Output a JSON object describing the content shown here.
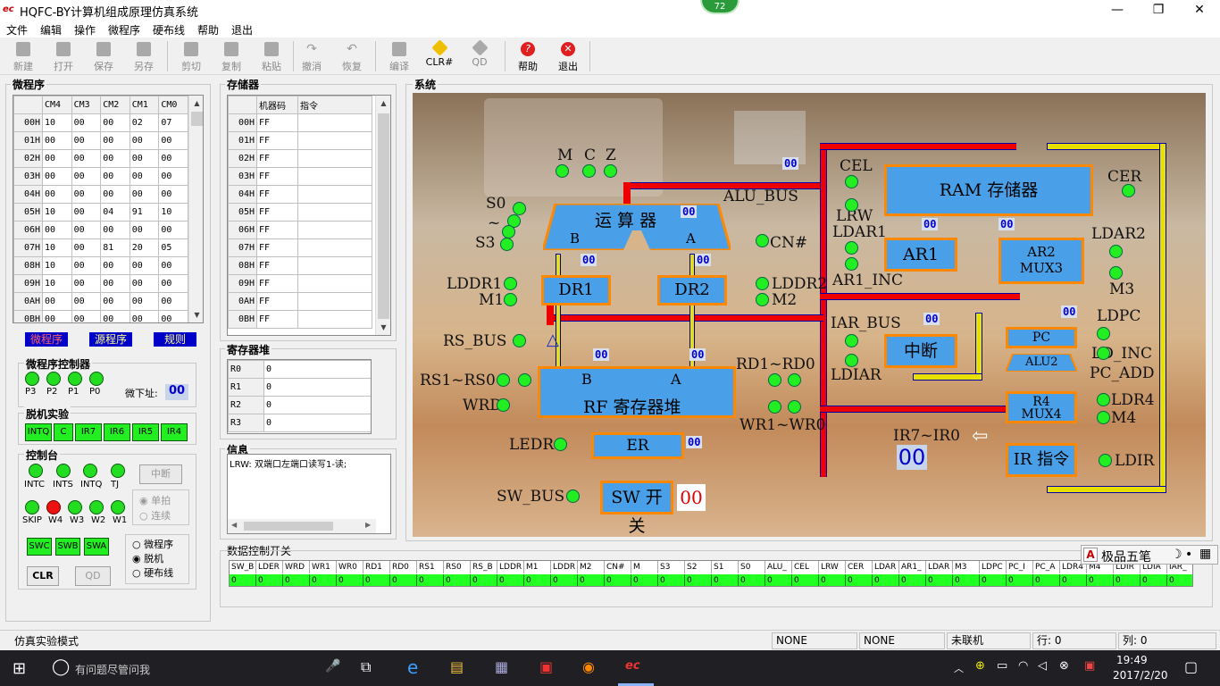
{
  "window": {
    "title": "HQFC-BY计算机组成原理仿真系统",
    "logo": "ec",
    "badge": "72",
    "btn_min": "—",
    "btn_max": "❐",
    "btn_close": "✕"
  },
  "menu": [
    "文件",
    "编辑",
    "操作",
    "微程序",
    "硬布线",
    "帮助",
    "退出"
  ],
  "toolbar": [
    "新建",
    "打开",
    "保存",
    "另存",
    "剪切",
    "复制",
    "粘贴",
    "撤消",
    "恢复",
    "编译",
    "CLR#",
    "QD",
    "帮助",
    "退出"
  ],
  "micro": {
    "title": "微程序",
    "cols": [
      "CM4",
      "CM3",
      "CM2",
      "CM1",
      "CM0"
    ],
    "rows": [
      {
        "addr": "00H",
        "v": [
          "10",
          "00",
          "00",
          "02",
          "07"
        ]
      },
      {
        "addr": "01H",
        "v": [
          "00",
          "00",
          "00",
          "00",
          "00"
        ]
      },
      {
        "addr": "02H",
        "v": [
          "00",
          "00",
          "00",
          "00",
          "00"
        ]
      },
      {
        "addr": "03H",
        "v": [
          "00",
          "00",
          "00",
          "00",
          "00"
        ]
      },
      {
        "addr": "04H",
        "v": [
          "00",
          "00",
          "00",
          "00",
          "00"
        ]
      },
      {
        "addr": "05H",
        "v": [
          "10",
          "00",
          "04",
          "91",
          "10"
        ]
      },
      {
        "addr": "06H",
        "v": [
          "00",
          "00",
          "00",
          "00",
          "00"
        ]
      },
      {
        "addr": "07H",
        "v": [
          "10",
          "00",
          "81",
          "20",
          "05"
        ]
      },
      {
        "addr": "08H",
        "v": [
          "10",
          "00",
          "00",
          "00",
          "00"
        ]
      },
      {
        "addr": "09H",
        "v": [
          "10",
          "00",
          "00",
          "00",
          "00"
        ]
      },
      {
        "addr": "0AH",
        "v": [
          "00",
          "00",
          "00",
          "00",
          "00"
        ]
      },
      {
        "addr": "0BH",
        "v": [
          "00",
          "00",
          "00",
          "00",
          "00"
        ]
      }
    ],
    "btn_micro": "微程序",
    "btn_src": "源程序",
    "btn_rule": "规则"
  },
  "mpc": {
    "title": "微程序控制器",
    "leds": [
      "P3",
      "P2",
      "P1",
      "P0"
    ],
    "addr_label": "微下址:",
    "addr_value": "00"
  },
  "offline": {
    "title": "脱机实验",
    "btns": [
      "INTQ",
      "C",
      "IR7",
      "IR6",
      "IR5",
      "IR4"
    ]
  },
  "console": {
    "title": "控制台",
    "leds1": [
      "INTC",
      "INTS",
      "INTQ",
      "TJ"
    ],
    "leds2": [
      "SKIP",
      "W4",
      "W3",
      "W2",
      "W1"
    ],
    "interrupt": "中断",
    "single": "单拍",
    "cont": "连续",
    "sw": [
      "SWC",
      "SWB",
      "SWA"
    ],
    "clr": "CLR",
    "qd": "QD",
    "modes": [
      "微程序",
      "脱机",
      "硬布线"
    ]
  },
  "memory": {
    "title": "存储器",
    "col1": "机器码",
    "col2": "指令",
    "rows": [
      {
        "addr": "00H",
        "code": "FF"
      },
      {
        "addr": "01H",
        "code": "FF"
      },
      {
        "addr": "02H",
        "code": "FF"
      },
      {
        "addr": "03H",
        "code": "FF"
      },
      {
        "addr": "04H",
        "code": "FF"
      },
      {
        "addr": "05H",
        "code": "FF"
      },
      {
        "addr": "06H",
        "code": "FF"
      },
      {
        "addr": "07H",
        "code": "FF"
      },
      {
        "addr": "08H",
        "code": "FF"
      },
      {
        "addr": "09H",
        "code": "FF"
      },
      {
        "addr": "0AH",
        "code": "FF"
      },
      {
        "addr": "0BH",
        "code": "FF"
      }
    ]
  },
  "regfile": {
    "title": "寄存器堆",
    "rows": [
      {
        "r": "R0",
        "v": "0"
      },
      {
        "r": "R1",
        "v": "0"
      },
      {
        "r": "R2",
        "v": "0"
      },
      {
        "r": "R3",
        "v": "0"
      }
    ]
  },
  "info": {
    "title": "信息",
    "text": "LRW: 双端口左端口读写1-读;"
  },
  "system": {
    "title": "系统",
    "alu": "运 算 器",
    "alu_b": "B",
    "alu_a": "A",
    "dr1": "DR1",
    "dr2": "DR2",
    "rf": "RF 寄存器堆",
    "rf_b": "B",
    "rf_a": "A",
    "er": "ER",
    "sw": "SW 开关",
    "sw_val": "00",
    "ram": "RAM 存储器",
    "ar1": "AR1",
    "ar2": "AR2",
    "mux3": "MUX3",
    "intr": "中断",
    "pc": "PC",
    "alu2": "ALU2",
    "r4": "R4",
    "mux4": "MUX4",
    "ir": "IR 指令",
    "labels": {
      "m": "M",
      "c": "C",
      "z": "Z",
      "s0": "S0",
      "tilde": "~",
      "s3": "S3",
      "alubus": "ALU_BUS",
      "cn": "CN#",
      "lddr1": "LDDR1",
      "m1": "M1",
      "lddr2": "LDDR2",
      "m2": "M2",
      "rsbus": "RS_BUS",
      "rs": "RS1~RS0",
      "wrd": "WRD",
      "rd": "RD1~RD0",
      "wr": "WR1~WR0",
      "ledr": "LEDR",
      "swbus": "SW_BUS",
      "cel": "CEL",
      "lrw": "LRW",
      "cer": "CER",
      "ldar1": "LDAR1",
      "ar1inc": "AR1_INC",
      "ldar2": "LDAR2",
      "m3": "M3",
      "iarbus": "IAR_BUS",
      "ldiar": "LDIAR",
      "ldpc": "LDPC",
      "ldinc": "LD_INC",
      "pcadd": "PC_ADD",
      "ldr4": "LDR4",
      "m4": "M4",
      "ir70": "IR7~IR0",
      "ir_val": "00",
      "ldir": "LDIR"
    },
    "hex": "00"
  },
  "dataswitch": {
    "title": "数据控制开关",
    "names": [
      "SW_B",
      "LDER",
      "WRD",
      "WR1",
      "WR0",
      "RD1",
      "RD0",
      "RS1",
      "RS0",
      "RS_B",
      "LDDR",
      "M1",
      "LDDR",
      "M2",
      "CN#",
      "M",
      "S3",
      "S2",
      "S1",
      "S0",
      "ALU_",
      "CEL",
      "LRW",
      "CER",
      "LDAR",
      "AR1_",
      "LDAR",
      "M3",
      "LDPC",
      "PC_I",
      "PC_A",
      "LDR4",
      "M4",
      "LDIR",
      "LDIA",
      "IAR_"
    ],
    "value": "0"
  },
  "ime": {
    "a": "A",
    "name": "极品五笔",
    "moon": "☽",
    "dot": "•",
    "kb": "▦"
  },
  "statusbar": {
    "mode": "仿真实验模式",
    "s1": "NONE",
    "s2": "NONE",
    "link": "未联机",
    "row": "行: 0",
    "col": "列: 0"
  },
  "taskbar": {
    "search": "有问题尽管问我",
    "time": "19:49",
    "date": "2017/2/20"
  }
}
